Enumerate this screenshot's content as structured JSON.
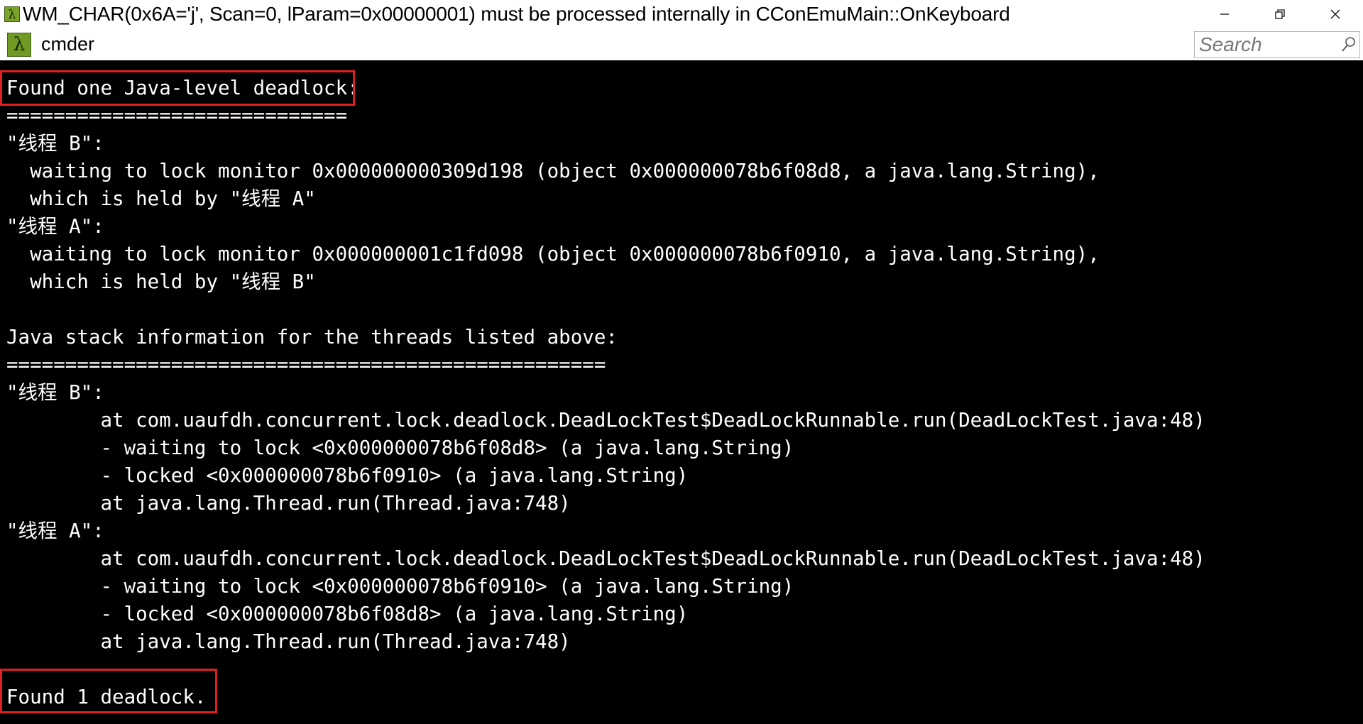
{
  "window": {
    "title": "WM_CHAR(0x6A='j', Scan=0, lParam=0x00000001) must be processed internally in CConEmuMain::OnKeyboard",
    "app_icon": "lambda-icon",
    "controls": {
      "minimize": "minimize-icon",
      "restore": "restore-icon",
      "close": "close-icon"
    }
  },
  "tabs": [
    {
      "label": "cmder",
      "icon": "lambda-icon"
    }
  ],
  "search": {
    "placeholder": "Search",
    "value": ""
  },
  "console": {
    "lines": [
      "Found one Java-level deadlock:",
      "=============================",
      "\"线程 B\":",
      "  waiting to lock monitor 0x000000000309d198 (object 0x000000078b6f08d8, a java.lang.String),",
      "  which is held by \"线程 A\"",
      "\"线程 A\":",
      "  waiting to lock monitor 0x000000001c1fd098 (object 0x000000078b6f0910, a java.lang.String),",
      "  which is held by \"线程 B\"",
      "",
      "Java stack information for the threads listed above:",
      "===================================================",
      "\"线程 B\":",
      "        at com.uaufdh.concurrent.lock.deadlock.DeadLockTest$DeadLockRunnable.run(DeadLockTest.java:48)",
      "        - waiting to lock <0x000000078b6f08d8> (a java.lang.String)",
      "        - locked <0x000000078b6f0910> (a java.lang.String)",
      "        at java.lang.Thread.run(Thread.java:748)",
      "\"线程 A\":",
      "        at com.uaufdh.concurrent.lock.deadlock.DeadLockTest$DeadLockRunnable.run(DeadLockTest.java:48)",
      "        - waiting to lock <0x000000078b6f0910> (a java.lang.String)",
      "        - locked <0x000000078b6f08d8> (a java.lang.String)",
      "        at java.lang.Thread.run(Thread.java:748)",
      "",
      "Found 1 deadlock."
    ]
  },
  "colors": {
    "console_background": "#000000",
    "console_text": "#ffffff",
    "highlight_border": "#e02020",
    "cmder_icon_green": "#6f9a23"
  }
}
